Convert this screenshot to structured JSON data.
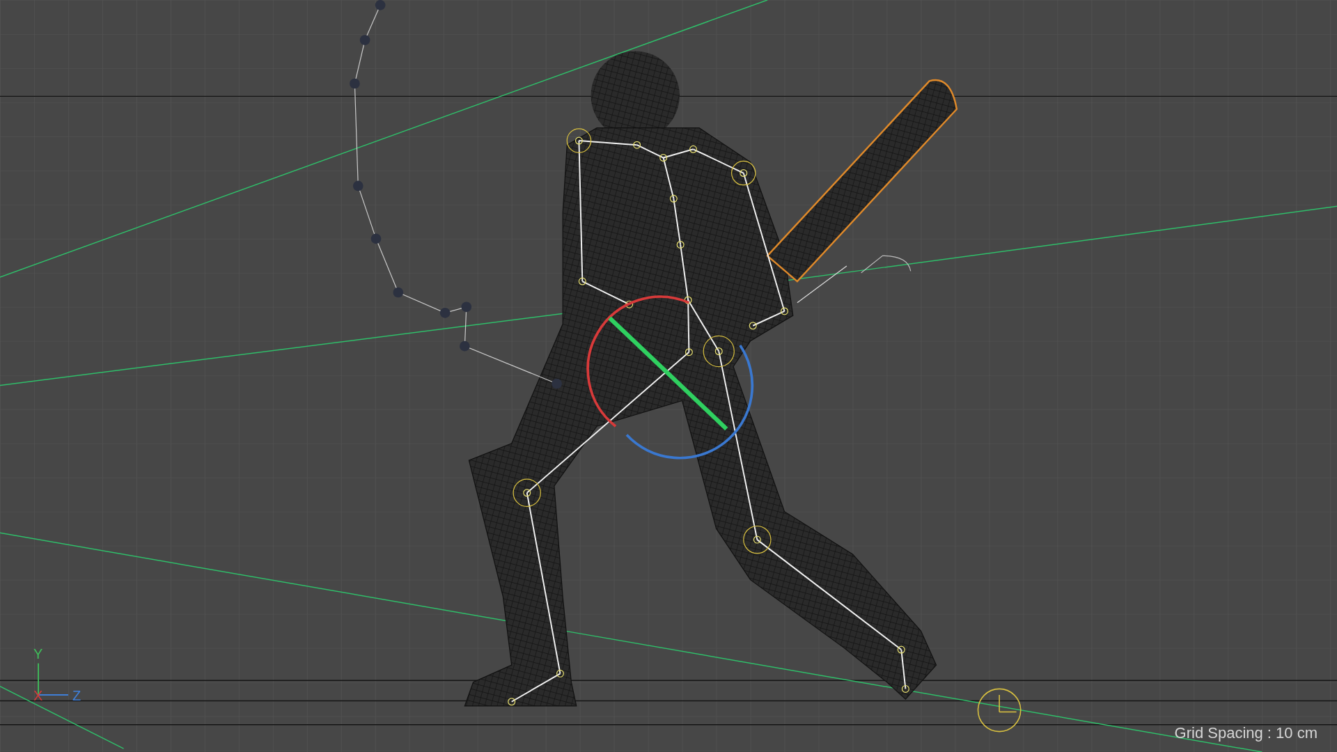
{
  "viewport": {
    "axis_labels": [
      {
        "text": "Y",
        "color": "#3fbf5a"
      },
      {
        "text": "X",
        "color": "#d23b3b"
      },
      {
        "text": "Z",
        "color": "#3f7fd8"
      }
    ],
    "grid_spacing": "Grid Spacing : 10 cm"
  }
}
